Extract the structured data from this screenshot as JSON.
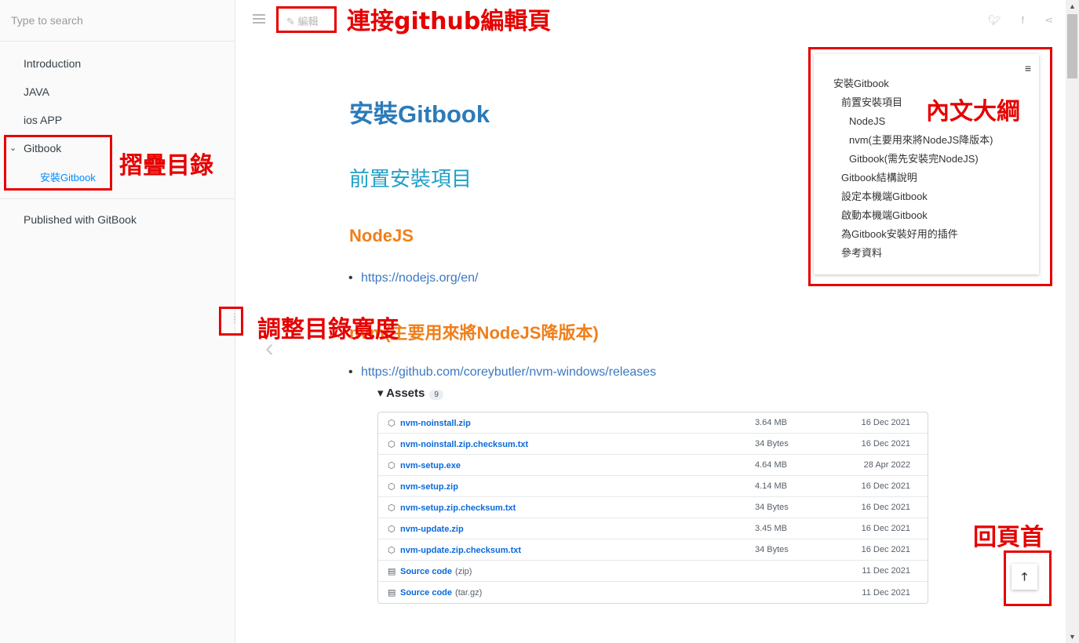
{
  "sidebar": {
    "search_placeholder": "Type to search",
    "items": [
      "Introduction",
      "JAVA",
      "ios APP",
      "Gitbook"
    ],
    "sub_item": "安裝Gitbook",
    "published": "Published with GitBook"
  },
  "topbar": {
    "edit_label": "編輯",
    "edit_icon": "✎",
    "share": {
      "twitter": "t",
      "facebook": "f",
      "share": "share"
    }
  },
  "content": {
    "h1": "安裝Gitbook",
    "h2": "前置安裝項目",
    "h3_nodejs": "NodeJS",
    "nodejs_link": "https://nodejs.org/en/",
    "h3_nvm": "nvm(主要用來將NodeJS降版本)",
    "nvm_link": "https://github.com/coreybutler/nvm-windows/releases",
    "assets_label": "▾ Assets",
    "assets_count": "9",
    "assets": [
      {
        "name": "nvm-noinstall.zip",
        "size": "3.64 MB",
        "date": "16 Dec 2021"
      },
      {
        "name": "nvm-noinstall.zip.checksum.txt",
        "size": "34 Bytes",
        "date": "16 Dec 2021"
      },
      {
        "name": "nvm-setup.exe",
        "size": "4.64 MB",
        "date": "28 Apr 2022"
      },
      {
        "name": "nvm-setup.zip",
        "size": "4.14 MB",
        "date": "16 Dec 2021"
      },
      {
        "name": "nvm-setup.zip.checksum.txt",
        "size": "34 Bytes",
        "date": "16 Dec 2021"
      },
      {
        "name": "nvm-update.zip",
        "size": "3.45 MB",
        "date": "16 Dec 2021"
      },
      {
        "name": "nvm-update.zip.checksum.txt",
        "size": "34 Bytes",
        "date": "16 Dec 2021"
      },
      {
        "name": "Source code",
        "sub": "(zip)",
        "size": "",
        "date": "11 Dec 2021"
      },
      {
        "name": "Source code",
        "sub": "(tar.gz)",
        "size": "",
        "date": "11 Dec 2021"
      }
    ]
  },
  "toc": {
    "items": [
      "安裝Gitbook",
      "前置安裝項目",
      "NodeJS",
      "nvm(主要用來將NodeJS降版本)",
      "Gitbook(需先安裝完NodeJS)",
      "Gitbook結構說明",
      "設定本機端Gitbook",
      "啟動本機端Gitbook",
      "為Gitbook安裝好用的插件",
      "參考資料"
    ]
  },
  "annotations": {
    "edit": "連接github編輯頁",
    "collapse": "摺疊目錄",
    "resize": "調整目錄寬度",
    "toc": "內文大綱",
    "backtop": "回頁首"
  },
  "colors": {
    "accent_red": "#e60000",
    "link": "#3b78c2",
    "h1": "#2b7bb9",
    "h3": "#f07f1a"
  }
}
